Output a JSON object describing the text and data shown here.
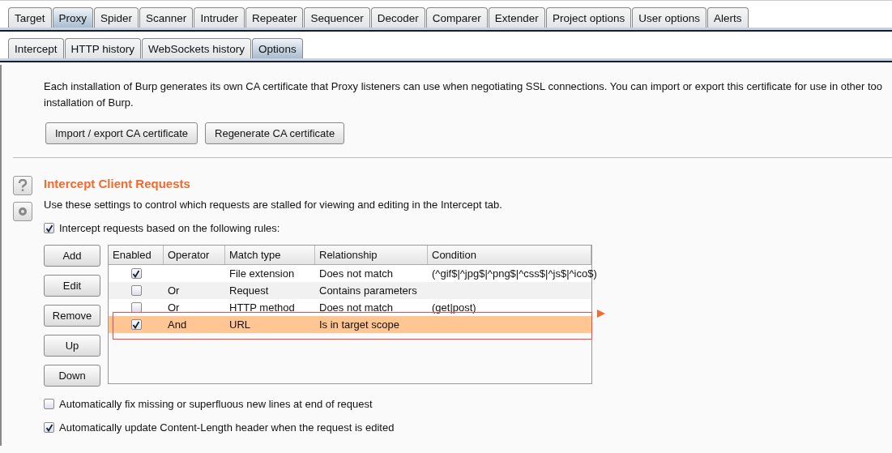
{
  "tabs": [
    {
      "label": "Target",
      "selected": false
    },
    {
      "label": "Proxy",
      "selected": true
    },
    {
      "label": "Spider",
      "selected": false
    },
    {
      "label": "Scanner",
      "selected": false
    },
    {
      "label": "Intruder",
      "selected": false
    },
    {
      "label": "Repeater",
      "selected": false
    },
    {
      "label": "Sequencer",
      "selected": false
    },
    {
      "label": "Decoder",
      "selected": false
    },
    {
      "label": "Comparer",
      "selected": false
    },
    {
      "label": "Extender",
      "selected": false
    },
    {
      "label": "Project options",
      "selected": false
    },
    {
      "label": "User options",
      "selected": false
    },
    {
      "label": "Alerts",
      "selected": false
    }
  ],
  "subtabs": [
    {
      "label": "Intercept",
      "selected": false
    },
    {
      "label": "HTTP history",
      "selected": false
    },
    {
      "label": "WebSockets history",
      "selected": false
    },
    {
      "label": "Options",
      "selected": true
    }
  ],
  "ca_section": {
    "description": "Each installation of Burp generates its own CA certificate that Proxy listeners can use when negotiating SSL connections. You can import or export this certificate for use in other too installation of Burp.",
    "buttons": [
      "Import / export CA certificate",
      "Regenerate CA certificate"
    ]
  },
  "intercept_section": {
    "title": "Intercept Client Requests",
    "description": "Use these settings to control which requests are stalled for viewing and editing in the Intercept tab.",
    "rules_toggle": {
      "label": "Intercept requests based on the following rules:",
      "checked": true
    },
    "buttons": [
      "Add",
      "Edit",
      "Remove",
      "Up",
      "Down"
    ],
    "table": {
      "columns": [
        "Enabled",
        "Operator",
        "Match type",
        "Relationship",
        "Condition"
      ],
      "rows": [
        {
          "enabled": true,
          "operator": "",
          "match_type": "File extension",
          "relationship": "Does not match",
          "condition": "(^gif$|^jpg$|^png$|^css$|^js$|^ico$)",
          "selected": false
        },
        {
          "enabled": false,
          "operator": "Or",
          "match_type": "Request",
          "relationship": "Contains parameters",
          "condition": "",
          "selected": false
        },
        {
          "enabled": false,
          "operator": "Or",
          "match_type": "HTTP method",
          "relationship": "Does not match",
          "condition": "(get|post)",
          "selected": false
        },
        {
          "enabled": true,
          "operator": "And",
          "match_type": "URL",
          "relationship": "Is in target scope",
          "condition": "",
          "selected": true
        }
      ]
    },
    "options": [
      {
        "label": "Automatically fix missing or superfluous new lines at end of request",
        "checked": false
      },
      {
        "label": "Automatically update Content-Length header when the request is edited",
        "checked": true
      }
    ]
  }
}
